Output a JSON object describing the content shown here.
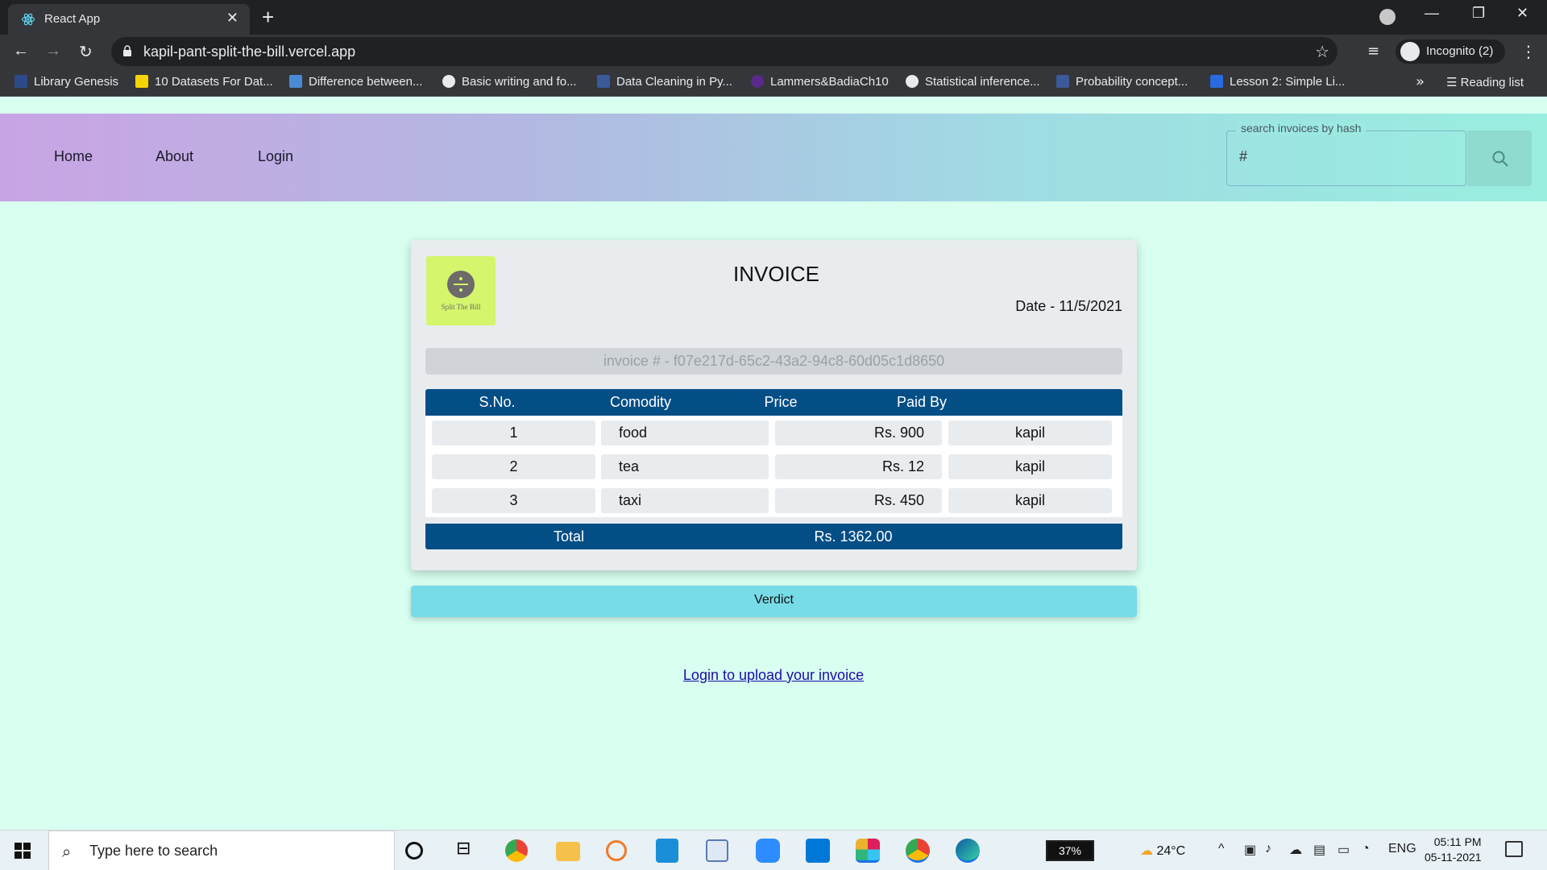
{
  "browser": {
    "tab_title": "React App",
    "url": "kapil-pant-split-the-bill.vercel.app",
    "profile_label": "Incognito (2)",
    "bookmarks": [
      "Library Genesis",
      "10 Datasets For Dat...",
      "Difference between...",
      "Basic writing and fo...",
      "Data Cleaning in Py...",
      "Lammers&BadiaCh10",
      "Statistical inference...",
      "Probability concept...",
      "Lesson 2: Simple Li..."
    ],
    "reading_list": "Reading list"
  },
  "navbar": {
    "links": [
      "Home",
      "About",
      "Login"
    ],
    "search_legend": "search invoices by hash",
    "search_value": "#"
  },
  "invoice": {
    "logo_text": "Split The Bill",
    "title": "INVOICE",
    "date": "Date - 11/5/2021",
    "hash": "invoice # - f07e217d-65c2-43a2-94c8-60d05c1d8650",
    "columns": [
      "S.No.",
      "Comodity",
      "Price",
      "Paid By"
    ],
    "rows": [
      {
        "sno": "1",
        "commodity": "food",
        "price": "Rs. 900",
        "paid_by": "kapil"
      },
      {
        "sno": "2",
        "commodity": "tea",
        "price": "Rs. 12",
        "paid_by": "kapil"
      },
      {
        "sno": "3",
        "commodity": "taxi",
        "price": "Rs. 450",
        "paid_by": "kapil"
      }
    ],
    "total_label": "Total",
    "total_value": "Rs. 1362.00"
  },
  "verdict_label": "Verdict",
  "login_link": "Login to upload your invoice",
  "taskbar": {
    "search_placeholder": "Type here to search",
    "battery": "37%",
    "weather": "24°C",
    "lang": "ENG",
    "time": "05:11 PM",
    "date": "05-11-2021"
  },
  "colors": {
    "page_bg": "#d8fff0",
    "table_header": "#044e86",
    "verdict_button": "#77dbe8",
    "logo_bg": "#d4f56c"
  }
}
